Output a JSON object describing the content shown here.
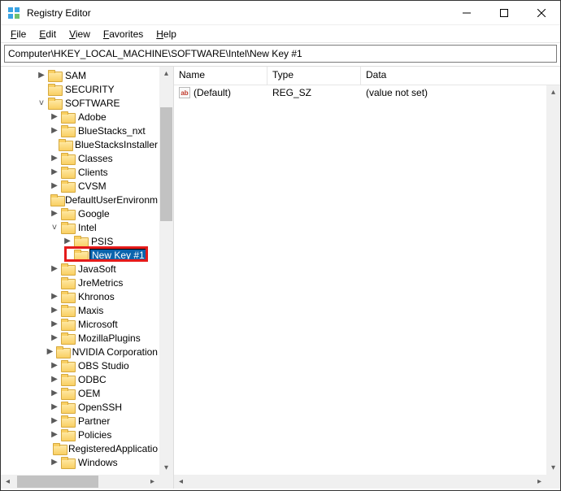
{
  "window": {
    "title": "Registry Editor"
  },
  "menu": {
    "file": "File",
    "edit": "Edit",
    "view": "View",
    "favorites": "Favorites",
    "help": "Help"
  },
  "address": {
    "path": "Computer\\HKEY_LOCAL_MACHINE\\SOFTWARE\\Intel\\New Key #1"
  },
  "tree": {
    "sam": "SAM",
    "security": "SECURITY",
    "software": "SOFTWARE",
    "adobe": "Adobe",
    "bluestacks_nxt": "BlueStacks_nxt",
    "bluestacksinstaller": "BlueStacksInstaller",
    "classes": "Classes",
    "clients": "Clients",
    "cvsm": "CVSM",
    "defaultuserenvironment": "DefaultUserEnvironm",
    "google": "Google",
    "intel": "Intel",
    "psis": "PSIS",
    "newkey1": "New Key #1",
    "javasoft": "JavaSoft",
    "jremetrics": "JreMetrics",
    "khronos": "Khronos",
    "maxis": "Maxis",
    "microsoft": "Microsoft",
    "mozillaplugins": "MozillaPlugins",
    "nvidia": "NVIDIA Corporation",
    "obs": "OBS Studio",
    "odbc": "ODBC",
    "oem": "OEM",
    "openssh": "OpenSSH",
    "partner": "Partner",
    "policies": "Policies",
    "registeredapps": "RegisteredApplicatio",
    "windows": "Windows"
  },
  "list": {
    "columns": {
      "name": "Name",
      "type": "Type",
      "data": "Data"
    },
    "rows": [
      {
        "name": "(Default)",
        "type": "REG_SZ",
        "data": "(value not set)"
      }
    ]
  }
}
